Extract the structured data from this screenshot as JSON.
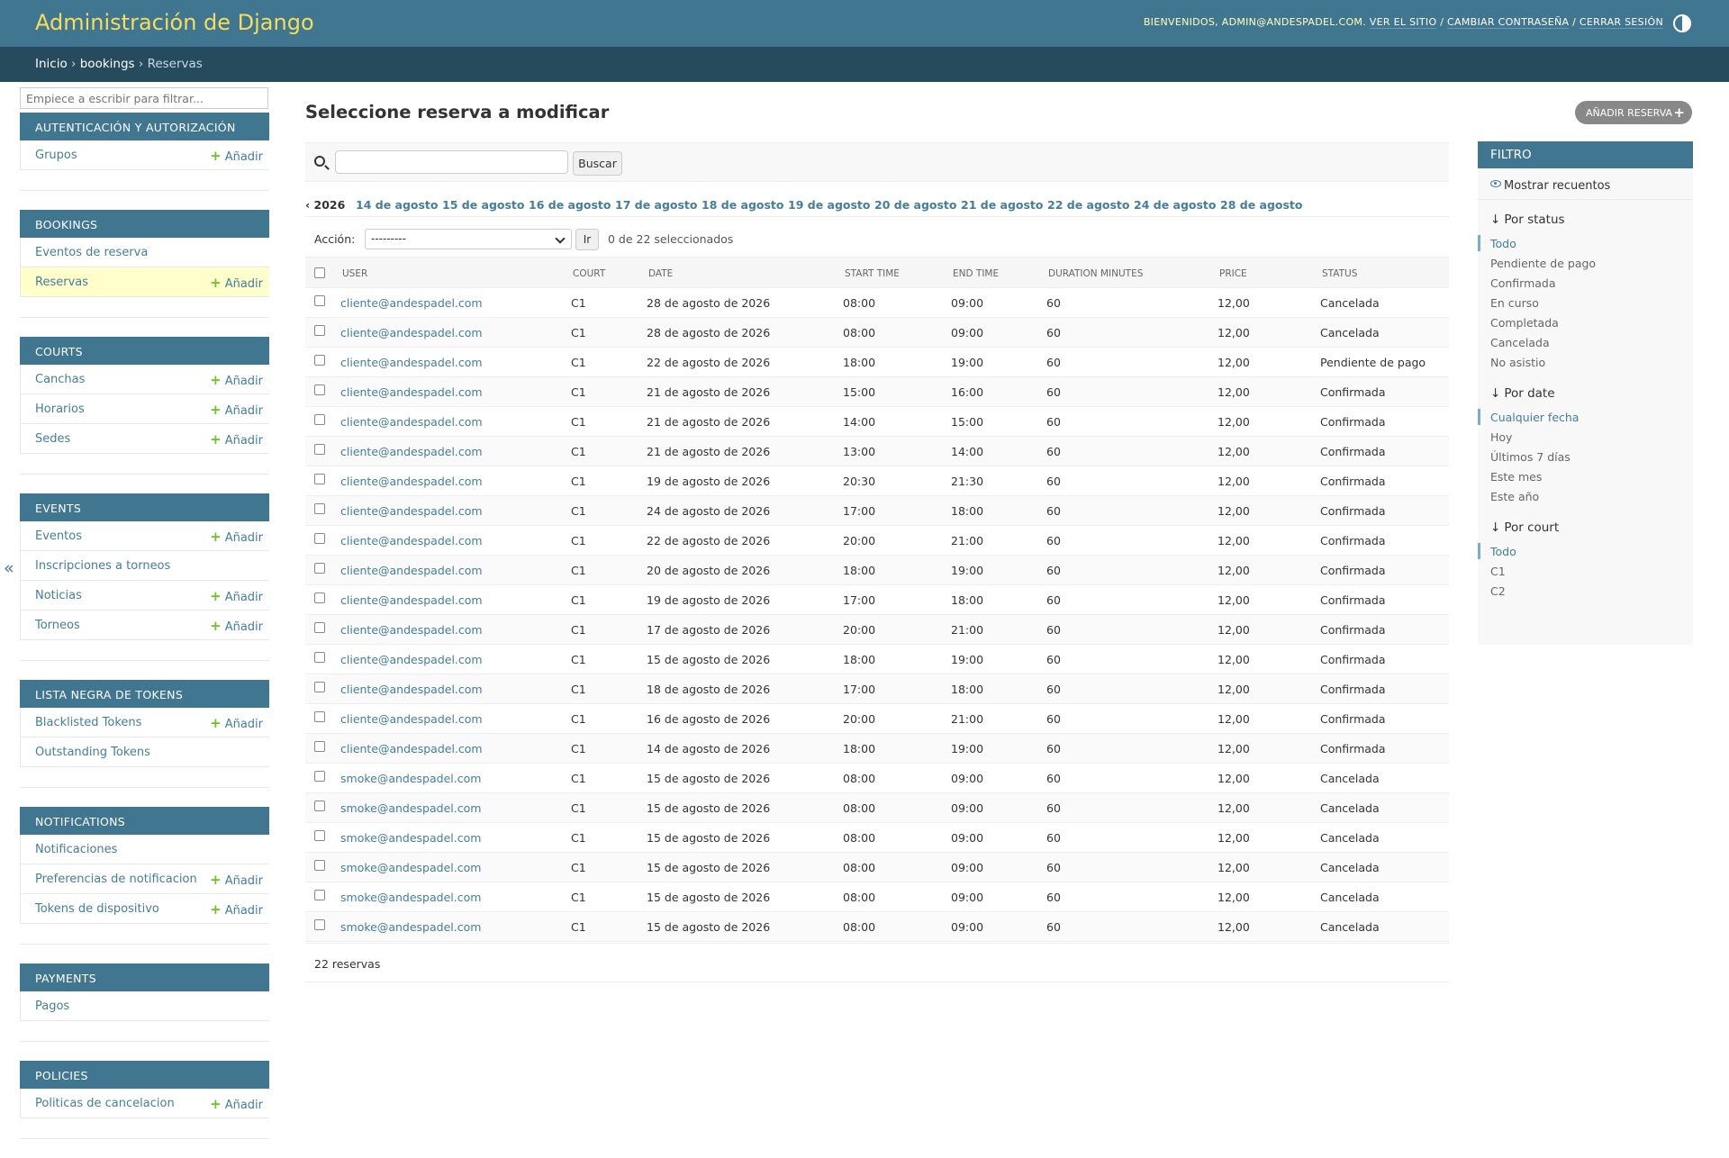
{
  "header": {
    "site_title": "Administración de Django",
    "welcome": "BIENVENIDOS, ADMIN@ANDESPADEL.COM.",
    "view_site": "VER EL SITIO",
    "change_password": "CAMBIAR CONTRASEÑA",
    "logout": "CERRAR SESIÓN",
    "sep": "/"
  },
  "breadcrumbs": {
    "home": "Inicio",
    "app": "bookings",
    "current": "Reservas",
    "sep": "›"
  },
  "nav": {
    "filter_placeholder": "Empiece a escribir para filtrar...",
    "add_label": "Añadir",
    "modules": [
      {
        "caption": "AUTENTICACIÓN Y AUTORIZACIÓN",
        "items": [
          {
            "label": "Grupos",
            "add": true
          }
        ]
      },
      {
        "caption": "BOOKINGS",
        "items": [
          {
            "label": "Eventos de reserva",
            "add": false
          },
          {
            "label": "Reservas",
            "add": true,
            "current": true
          }
        ]
      },
      {
        "caption": "COURTS",
        "items": [
          {
            "label": "Canchas",
            "add": true
          },
          {
            "label": "Horarios",
            "add": true
          },
          {
            "label": "Sedes",
            "add": true
          }
        ]
      },
      {
        "caption": "EVENTS",
        "items": [
          {
            "label": "Eventos",
            "add": true
          },
          {
            "label": "Inscripciones a torneos",
            "add": false
          },
          {
            "label": "Noticias",
            "add": true
          },
          {
            "label": "Torneos",
            "add": true
          }
        ]
      },
      {
        "caption": "LISTA NEGRA DE TOKENS",
        "items": [
          {
            "label": "Blacklisted Tokens",
            "add": true
          },
          {
            "label": "Outstanding Tokens",
            "add": false
          }
        ]
      },
      {
        "caption": "NOTIFICATIONS",
        "items": [
          {
            "label": "Notificaciones",
            "add": false
          },
          {
            "label": "Preferencias de notificacion",
            "add": true
          },
          {
            "label": "Tokens de dispositivo",
            "add": true
          }
        ]
      },
      {
        "caption": "PAYMENTS",
        "items": [
          {
            "label": "Pagos",
            "add": false
          }
        ]
      },
      {
        "caption": "POLICIES",
        "items": [
          {
            "label": "Politicas de cancelacion",
            "add": true
          }
        ]
      }
    ],
    "collapse_label": "«"
  },
  "main": {
    "title": "Seleccione reserva a modificar",
    "add_button": "AÑADIR RESERVA",
    "search_button": "Buscar",
    "date_back": "‹ 2026",
    "date_links": [
      "14 de agosto",
      "15 de agosto",
      "16 de agosto",
      "17 de agosto",
      "18 de agosto",
      "19 de agosto",
      "20 de agosto",
      "21 de agosto",
      "22 de agosto",
      "24 de agosto",
      "28 de agosto"
    ],
    "action_label": "Acción:",
    "action_default": "---------",
    "action_go": "Ir",
    "selected_count": "0 de 22 seleccionados",
    "columns": [
      "USER",
      "COURT",
      "DATE",
      "START TIME",
      "END TIME",
      "DURATION MINUTES",
      "PRICE",
      "STATUS"
    ],
    "rows": [
      [
        "cliente@andespadel.com",
        "C1",
        "28 de agosto de 2026",
        "08:00",
        "09:00",
        "60",
        "12,00",
        "Cancelada"
      ],
      [
        "cliente@andespadel.com",
        "C1",
        "28 de agosto de 2026",
        "08:00",
        "09:00",
        "60",
        "12,00",
        "Cancelada"
      ],
      [
        "cliente@andespadel.com",
        "C1",
        "22 de agosto de 2026",
        "18:00",
        "19:00",
        "60",
        "12,00",
        "Pendiente de pago"
      ],
      [
        "cliente@andespadel.com",
        "C1",
        "21 de agosto de 2026",
        "15:00",
        "16:00",
        "60",
        "12,00",
        "Confirmada"
      ],
      [
        "cliente@andespadel.com",
        "C1",
        "21 de agosto de 2026",
        "14:00",
        "15:00",
        "60",
        "12,00",
        "Confirmada"
      ],
      [
        "cliente@andespadel.com",
        "C1",
        "21 de agosto de 2026",
        "13:00",
        "14:00",
        "60",
        "12,00",
        "Confirmada"
      ],
      [
        "cliente@andespadel.com",
        "C1",
        "19 de agosto de 2026",
        "20:30",
        "21:30",
        "60",
        "12,00",
        "Confirmada"
      ],
      [
        "cliente@andespadel.com",
        "C1",
        "24 de agosto de 2026",
        "17:00",
        "18:00",
        "60",
        "12,00",
        "Confirmada"
      ],
      [
        "cliente@andespadel.com",
        "C1",
        "22 de agosto de 2026",
        "20:00",
        "21:00",
        "60",
        "12,00",
        "Confirmada"
      ],
      [
        "cliente@andespadel.com",
        "C1",
        "20 de agosto de 2026",
        "18:00",
        "19:00",
        "60",
        "12,00",
        "Confirmada"
      ],
      [
        "cliente@andespadel.com",
        "C1",
        "19 de agosto de 2026",
        "17:00",
        "18:00",
        "60",
        "12,00",
        "Confirmada"
      ],
      [
        "cliente@andespadel.com",
        "C1",
        "17 de agosto de 2026",
        "20:00",
        "21:00",
        "60",
        "12,00",
        "Confirmada"
      ],
      [
        "cliente@andespadel.com",
        "C1",
        "15 de agosto de 2026",
        "18:00",
        "19:00",
        "60",
        "12,00",
        "Confirmada"
      ],
      [
        "cliente@andespadel.com",
        "C1",
        "18 de agosto de 2026",
        "17:00",
        "18:00",
        "60",
        "12,00",
        "Confirmada"
      ],
      [
        "cliente@andespadel.com",
        "C1",
        "16 de agosto de 2026",
        "20:00",
        "21:00",
        "60",
        "12,00",
        "Confirmada"
      ],
      [
        "cliente@andespadel.com",
        "C1",
        "14 de agosto de 2026",
        "18:00",
        "19:00",
        "60",
        "12,00",
        "Confirmada"
      ],
      [
        "smoke@andespadel.com",
        "C1",
        "15 de agosto de 2026",
        "08:00",
        "09:00",
        "60",
        "12,00",
        "Cancelada"
      ],
      [
        "smoke@andespadel.com",
        "C1",
        "15 de agosto de 2026",
        "08:00",
        "09:00",
        "60",
        "12,00",
        "Cancelada"
      ],
      [
        "smoke@andespadel.com",
        "C1",
        "15 de agosto de 2026",
        "08:00",
        "09:00",
        "60",
        "12,00",
        "Cancelada"
      ],
      [
        "smoke@andespadel.com",
        "C1",
        "15 de agosto de 2026",
        "08:00",
        "09:00",
        "60",
        "12,00",
        "Cancelada"
      ],
      [
        "smoke@andespadel.com",
        "C1",
        "15 de agosto de 2026",
        "08:00",
        "09:00",
        "60",
        "12,00",
        "Cancelada"
      ],
      [
        "smoke@andespadel.com",
        "C1",
        "15 de agosto de 2026",
        "08:00",
        "09:00",
        "60",
        "12,00",
        "Cancelada"
      ]
    ],
    "footer": "22 reservas"
  },
  "filter": {
    "caption": "FILTRO",
    "show_counts": "Mostrar recuentos",
    "groups": [
      {
        "title": "Por status",
        "items": [
          "Todo",
          "Pendiente de pago",
          "Confirmada",
          "En curso",
          "Completada",
          "Cancelada",
          "No asistio"
        ],
        "selected": 0
      },
      {
        "title": "Por date",
        "items": [
          "Cualquier fecha",
          "Hoy",
          "Últimos 7 días",
          "Este mes",
          "Este año"
        ],
        "selected": 0
      },
      {
        "title": "Por court",
        "items": [
          "Todo",
          "C1",
          "C2"
        ],
        "selected": 0
      }
    ]
  },
  "colors": {
    "header_bg": "#417690",
    "breadcrumbs_bg": "#264b5d",
    "site_title": "#f5dd5d",
    "link": "#447e9b",
    "add_plus": "#70bf2b",
    "current_row": "#ffffcc"
  }
}
